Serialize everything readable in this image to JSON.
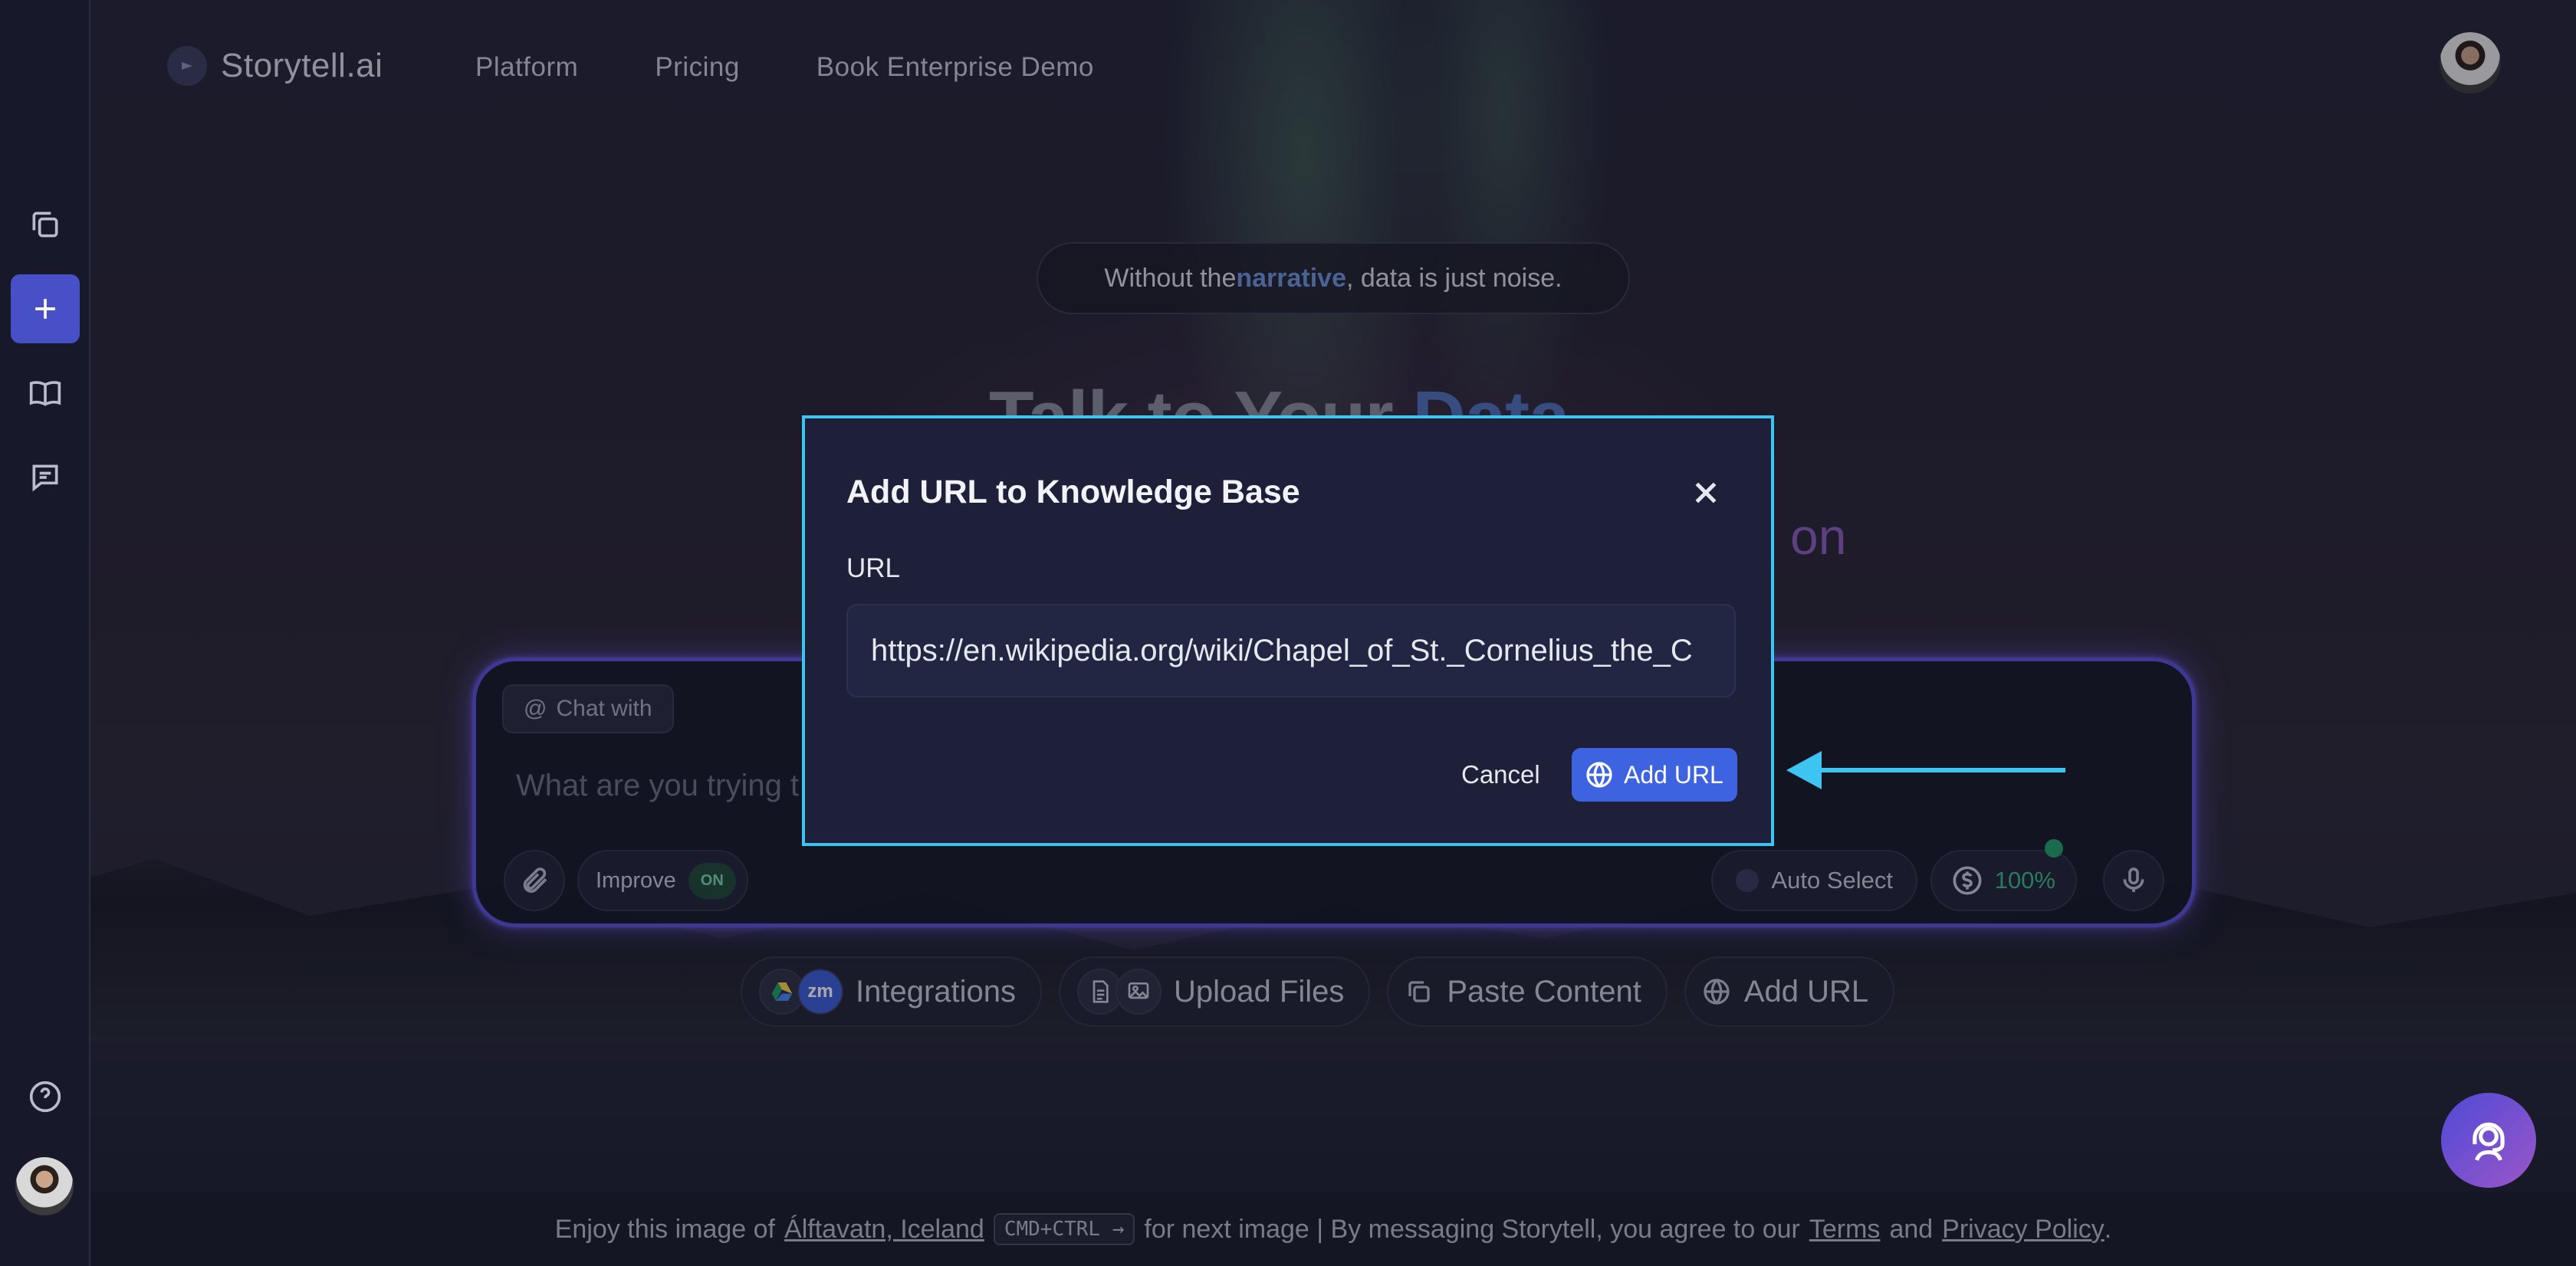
{
  "brand": {
    "name": "Storytell.ai"
  },
  "nav": {
    "items": [
      "Platform",
      "Pricing",
      "Book Enterprise Demo"
    ]
  },
  "tagline": {
    "before": "Without the ",
    "highlight": "narrative",
    "after": ", data is just noise."
  },
  "hero": {
    "title_start": "Talk to Your ",
    "title_highlight": "Data",
    "subtitle_fragment": "g on"
  },
  "chat": {
    "chat_with_label": "Chat with",
    "placeholder": "What are you trying t",
    "improve_label": "Improve",
    "improve_state": "ON",
    "auto_select_label": "Auto Select",
    "credits_value": "100%"
  },
  "actions": [
    {
      "label": "Integrations",
      "icons": [
        "google-drive-icon",
        "zoom-icon"
      ],
      "zoom_text": "zm"
    },
    {
      "label": "Upload Files",
      "icons": [
        "document-icon",
        "image-icon"
      ]
    },
    {
      "label": "Paste Content",
      "icons": [
        "copy-icon"
      ]
    },
    {
      "label": "Add URL",
      "icons": [
        "globe-icon"
      ]
    }
  ],
  "modal": {
    "title": "Add URL to Knowledge Base",
    "field_label": "URL",
    "field_value": "https://en.wikipedia.org/wiki/Chapel_of_St._Cornelius_the_C",
    "cancel_label": "Cancel",
    "submit_label": "Add URL"
  },
  "footer": {
    "prefix": "Enjoy this image of",
    "location_link": "Álftavatn, Iceland",
    "shortcut": "CMD+CTRL →",
    "middle": "for next image | By messaging Storytell, you agree to our",
    "terms_link": "Terms",
    "and": "and",
    "privacy_link": "Privacy Policy",
    "end": "."
  },
  "colors": {
    "accent": "#4850c8",
    "highlight": "#6f93d9",
    "modal_border": "#3ec4f0",
    "arrow": "#3ec4f0",
    "primary_button": "#3d63e0",
    "on_badge": "#1f4a3a",
    "credits_green": "#3cb884"
  }
}
